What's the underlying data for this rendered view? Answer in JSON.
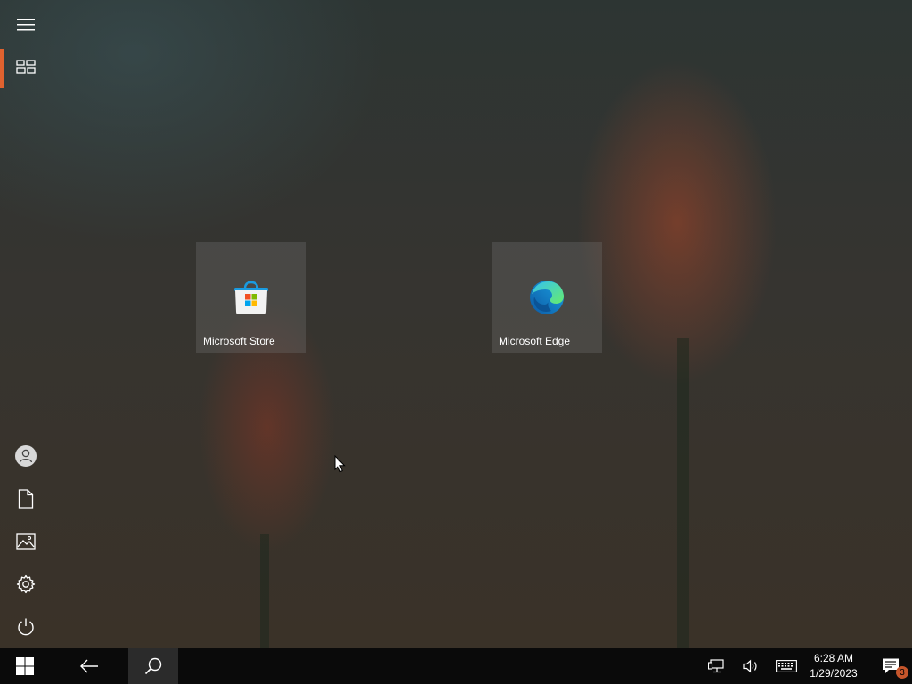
{
  "start_menu": {
    "rail": [
      {
        "name": "expand",
        "icon": "hamburger-icon"
      },
      {
        "name": "all-apps",
        "icon": "tiles-icon",
        "active": true
      },
      {
        "name": "user",
        "icon": "user-icon"
      },
      {
        "name": "documents",
        "icon": "document-icon"
      },
      {
        "name": "pictures",
        "icon": "pictures-icon"
      },
      {
        "name": "settings",
        "icon": "gear-icon"
      },
      {
        "name": "power",
        "icon": "power-icon"
      }
    ],
    "tiles": [
      {
        "label": "Microsoft Store",
        "icon": "store-icon"
      },
      {
        "label": "Microsoft Edge",
        "icon": "edge-icon"
      }
    ]
  },
  "taskbar": {
    "buttons": [
      "windows-icon",
      "back-icon",
      "search-icon"
    ],
    "tray": [
      "network-icon",
      "volume-icon",
      "keyboard-icon"
    ],
    "time": "6:28 AM",
    "date": "1/29/2023",
    "notification_count": "3"
  },
  "colors": {
    "accent": "#e0622f",
    "taskbar": "#0a0a0a",
    "tile": "#787878"
  }
}
